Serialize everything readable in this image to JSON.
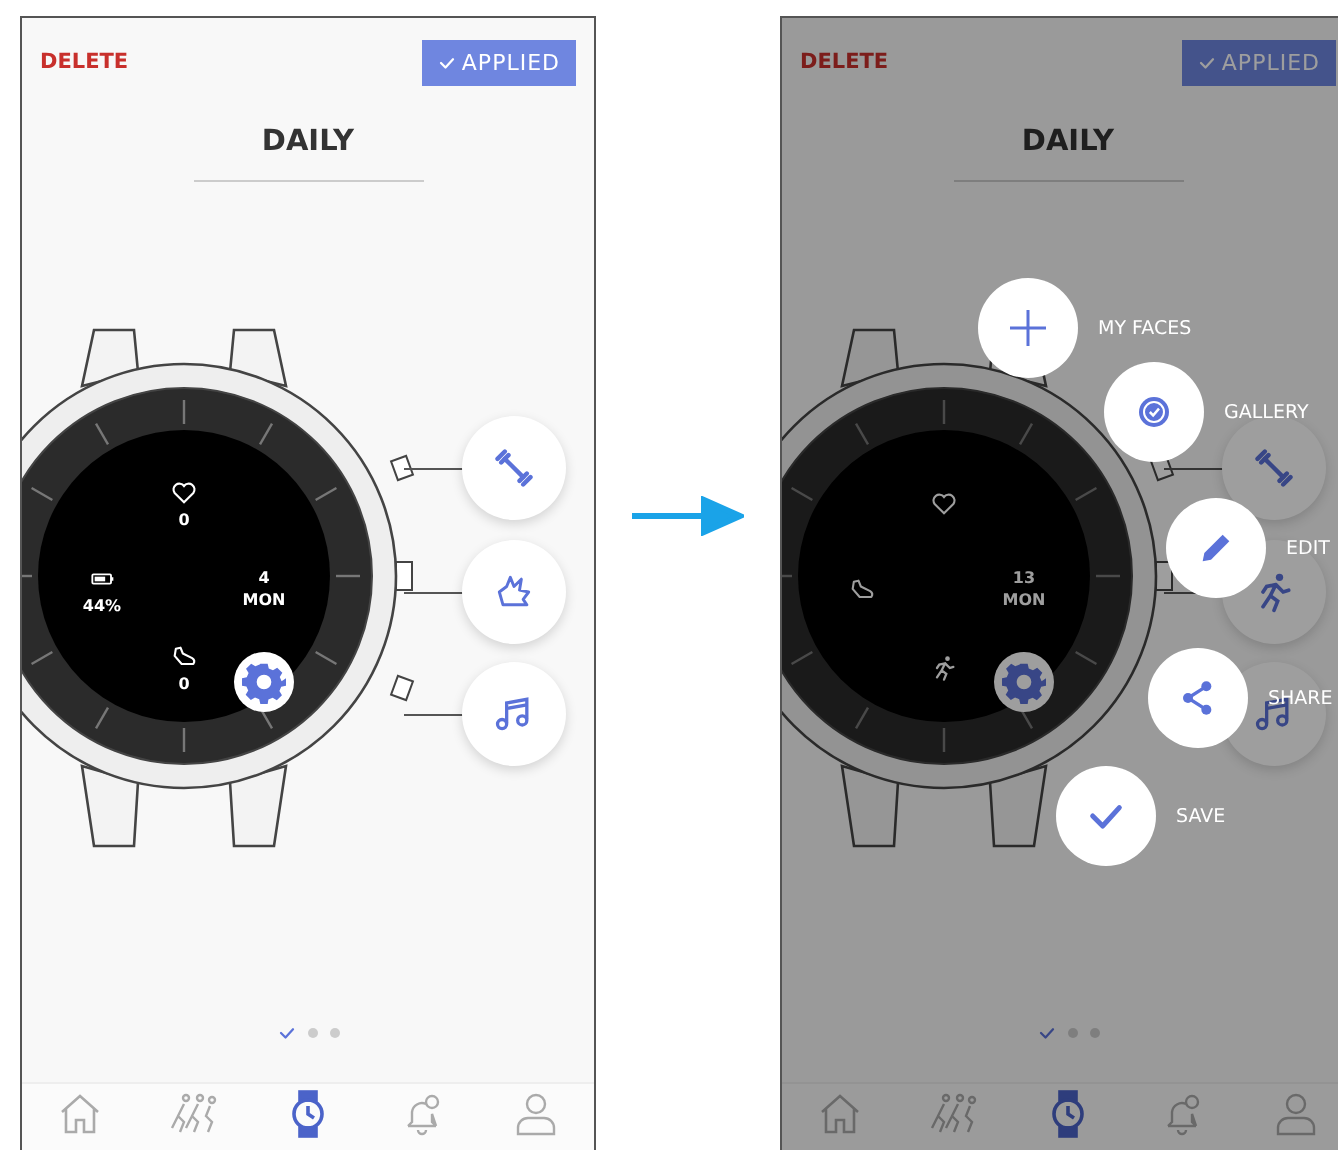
{
  "screens": [
    {
      "dimmed": false,
      "delete": "DELETE",
      "applied": "APPLIED",
      "title": "DAILY",
      "complications": [
        {
          "kind": "heart",
          "value": "0"
        },
        {
          "kind": "battery",
          "value": "44%"
        },
        {
          "kind": "date",
          "value": "4",
          "label": "MON"
        },
        {
          "kind": "shoe",
          "value": "0"
        }
      ],
      "side_buttons": [
        {
          "kind": "dumbbell"
        },
        {
          "kind": "gesture"
        },
        {
          "kind": "music"
        }
      ],
      "pager": [
        {
          "selected": true
        },
        {
          "selected": false
        },
        {
          "selected": false
        }
      ],
      "nav": [
        {
          "kind": "home",
          "selected": false
        },
        {
          "kind": "runners",
          "selected": false
        },
        {
          "kind": "watch",
          "selected": true
        },
        {
          "kind": "bell",
          "selected": false
        },
        {
          "kind": "person",
          "selected": false
        }
      ]
    },
    {
      "dimmed": true,
      "delete": "DELETE",
      "applied": "APPLIED",
      "title": "DAILY",
      "complications": [
        {
          "kind": "heart"
        },
        {
          "kind": "shoe"
        },
        {
          "kind": "date",
          "value": "13",
          "label": "MON"
        },
        {
          "kind": "runner"
        }
      ],
      "side_buttons": [
        {
          "kind": "dumbbell"
        },
        {
          "kind": "runner"
        },
        {
          "kind": "music"
        }
      ],
      "pager": [
        {
          "selected": true
        },
        {
          "selected": false
        },
        {
          "selected": false
        }
      ],
      "nav": [
        {
          "kind": "home",
          "selected": false
        },
        {
          "kind": "runners",
          "selected": false
        },
        {
          "kind": "watch",
          "selected": true
        },
        {
          "kind": "bell",
          "selected": false
        },
        {
          "kind": "person",
          "selected": false
        }
      ],
      "menu": [
        {
          "kind": "add",
          "label": "MY FACES"
        },
        {
          "kind": "gallery",
          "label": "GALLERY"
        },
        {
          "kind": "edit",
          "label": "EDIT"
        },
        {
          "kind": "share",
          "label": "SHARE"
        },
        {
          "kind": "save",
          "label": "SAVE"
        }
      ]
    }
  ]
}
